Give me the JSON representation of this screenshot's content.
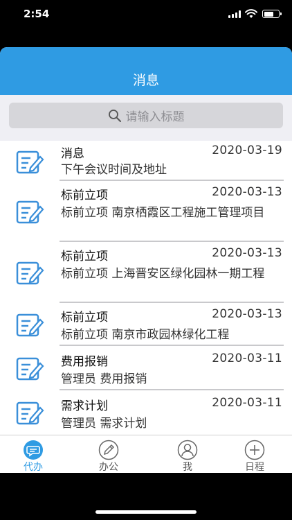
{
  "status": {
    "time": "2:54"
  },
  "header": {
    "title": "消息"
  },
  "search": {
    "placeholder": "请输入标题"
  },
  "messages": [
    {
      "title": "消息",
      "date": "2020-03-19",
      "body": "下午会议时间及地址"
    },
    {
      "title": "标前立项",
      "date": "2020-03-13",
      "body": "标前立项 南京栖霞区工程施工管理项目"
    },
    {
      "title": "标前立项",
      "date": "2020-03-13",
      "body": "标前立项 上海晋安区绿化园林一期工程"
    },
    {
      "title": "标前立项",
      "date": "2020-03-13",
      "body": "标前立项 南京市政园林绿化工程"
    },
    {
      "title": "费用报销",
      "date": "2020-03-11",
      "body": "管理员 费用报销"
    },
    {
      "title": "需求计划",
      "date": "2020-03-11",
      "body": "管理员 需求计划"
    }
  ],
  "tabs": [
    {
      "label": "代办",
      "icon": "chat-bubble-icon",
      "active": true
    },
    {
      "label": "办公",
      "icon": "pencil-icon",
      "active": false
    },
    {
      "label": "我",
      "icon": "user-icon",
      "active": false
    },
    {
      "label": "日程",
      "icon": "plus-circle-icon",
      "active": false
    }
  ],
  "colors": {
    "accent": "#2f9be3",
    "icon_blue": "#3a8fd9"
  }
}
